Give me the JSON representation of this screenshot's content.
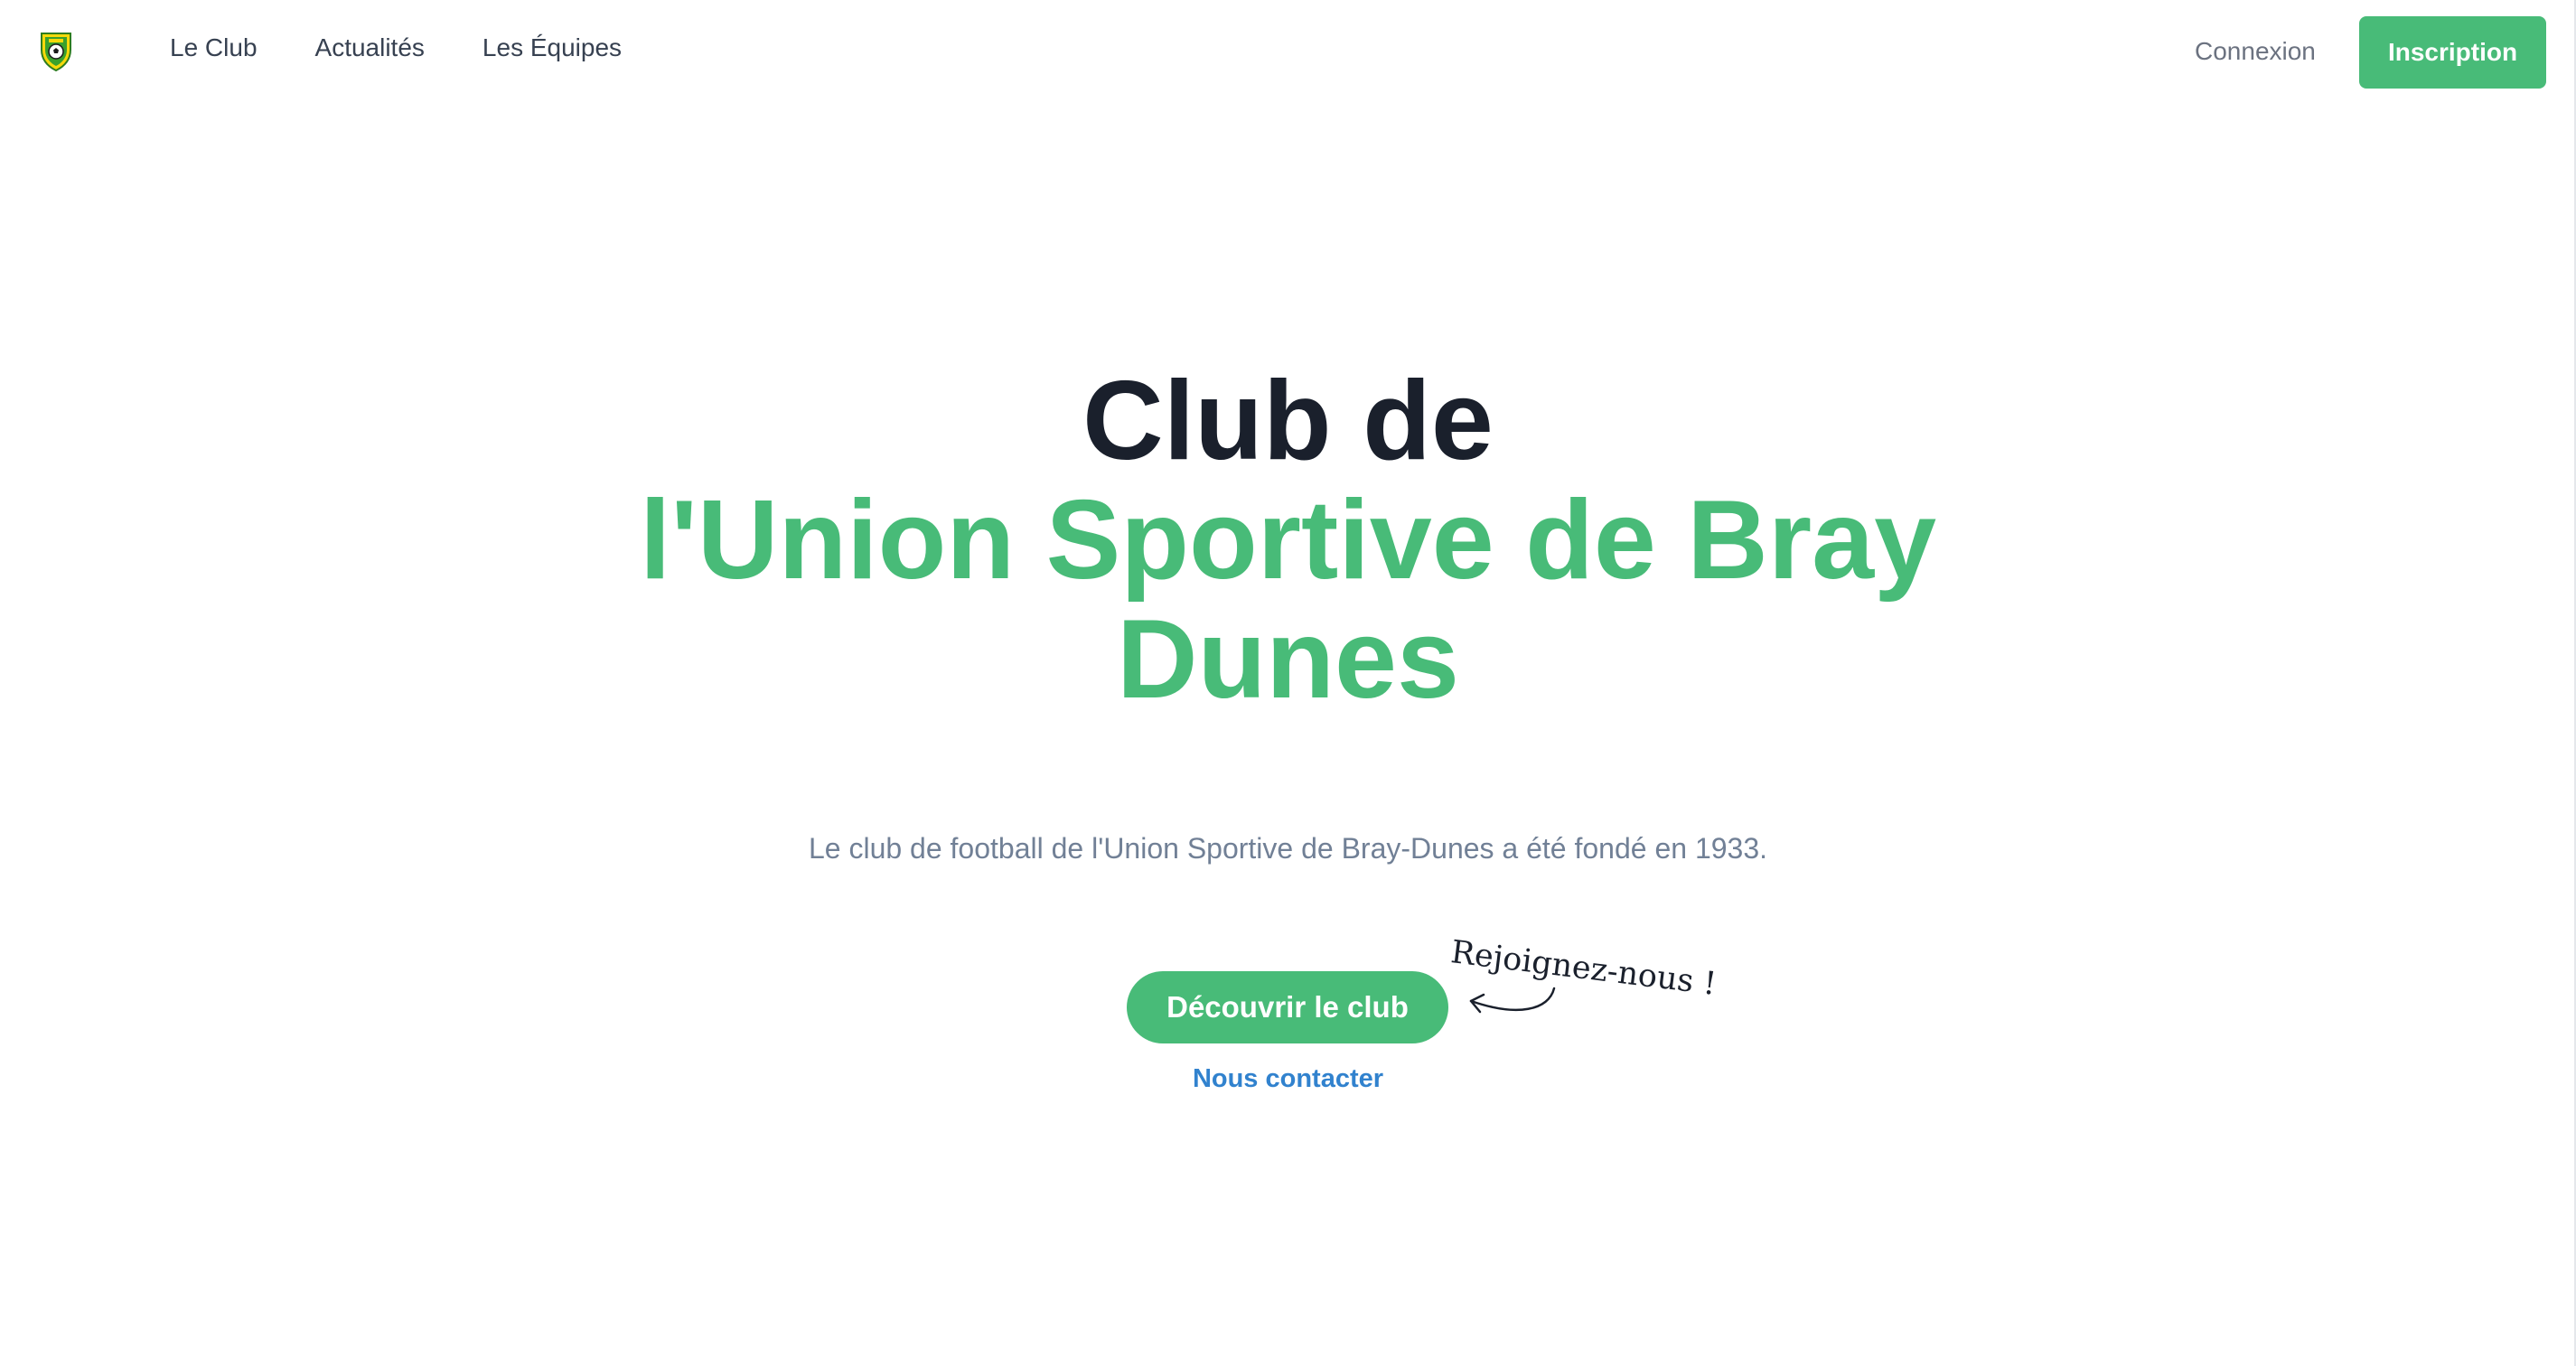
{
  "nav": {
    "links": [
      "Le Club",
      "Actualités",
      "Les Équipes"
    ],
    "login": "Connexion",
    "signup": "Inscription"
  },
  "hero": {
    "title_line1": "Club de",
    "title_line2a": "l'Union Sportive de Bray",
    "title_line2b": "Dunes",
    "subtitle": "Le club de football de l'Union Sportive de Bray-Dunes a été fondé en 1933.",
    "cta": "Découvrir le club",
    "contact": "Nous contacter",
    "note": "Rejoignez-nous !"
  },
  "colors": {
    "accent": "#48bb78",
    "heading": "#1a202c",
    "link": "#3182ce",
    "muted": "#718096"
  },
  "icons": {
    "logo": "club-crest-icon",
    "arrow": "curved-arrow-icon"
  }
}
